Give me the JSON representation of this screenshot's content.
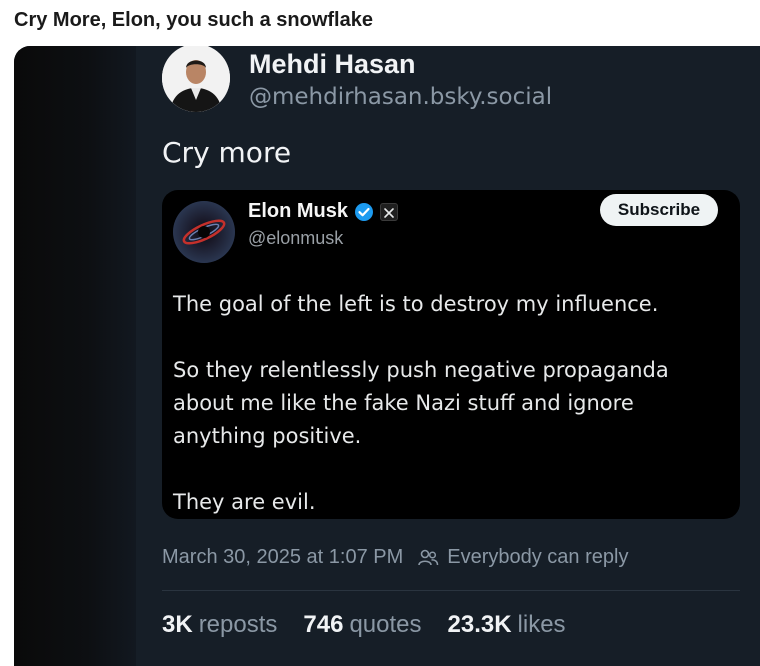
{
  "page": {
    "title": "Cry More, Elon, you such a snowflake"
  },
  "post": {
    "author_name": "Mehdi Hasan",
    "author_handle": "@mehdirhasan.bsky.social",
    "text": "Cry more",
    "timestamp": "March 30, 2025 at 1:07 PM",
    "reply_setting": "Everybody can reply",
    "stats": {
      "reposts_count": "3K",
      "reposts_label": "reposts",
      "quotes_count": "746",
      "quotes_label": "quotes",
      "likes_count": "23.3K",
      "likes_label": "likes"
    }
  },
  "embed": {
    "author_name": "Elon Musk",
    "author_handle": "@elonmusk",
    "subscribe_label": "Subscribe",
    "paragraphs": [
      "The goal of the left is to destroy my influence.",
      "So they relentlessly push negative propaganda about me like the fake Nazi stuff and ignore anything positive.",
      "They are evil."
    ]
  },
  "colors": {
    "background": "#161e27",
    "card": "#000000",
    "muted_text": "#8b98a5",
    "verified": "#1d9bf0"
  },
  "icons": [
    "verified-badge-icon",
    "x-logo-icon",
    "people-icon"
  ]
}
